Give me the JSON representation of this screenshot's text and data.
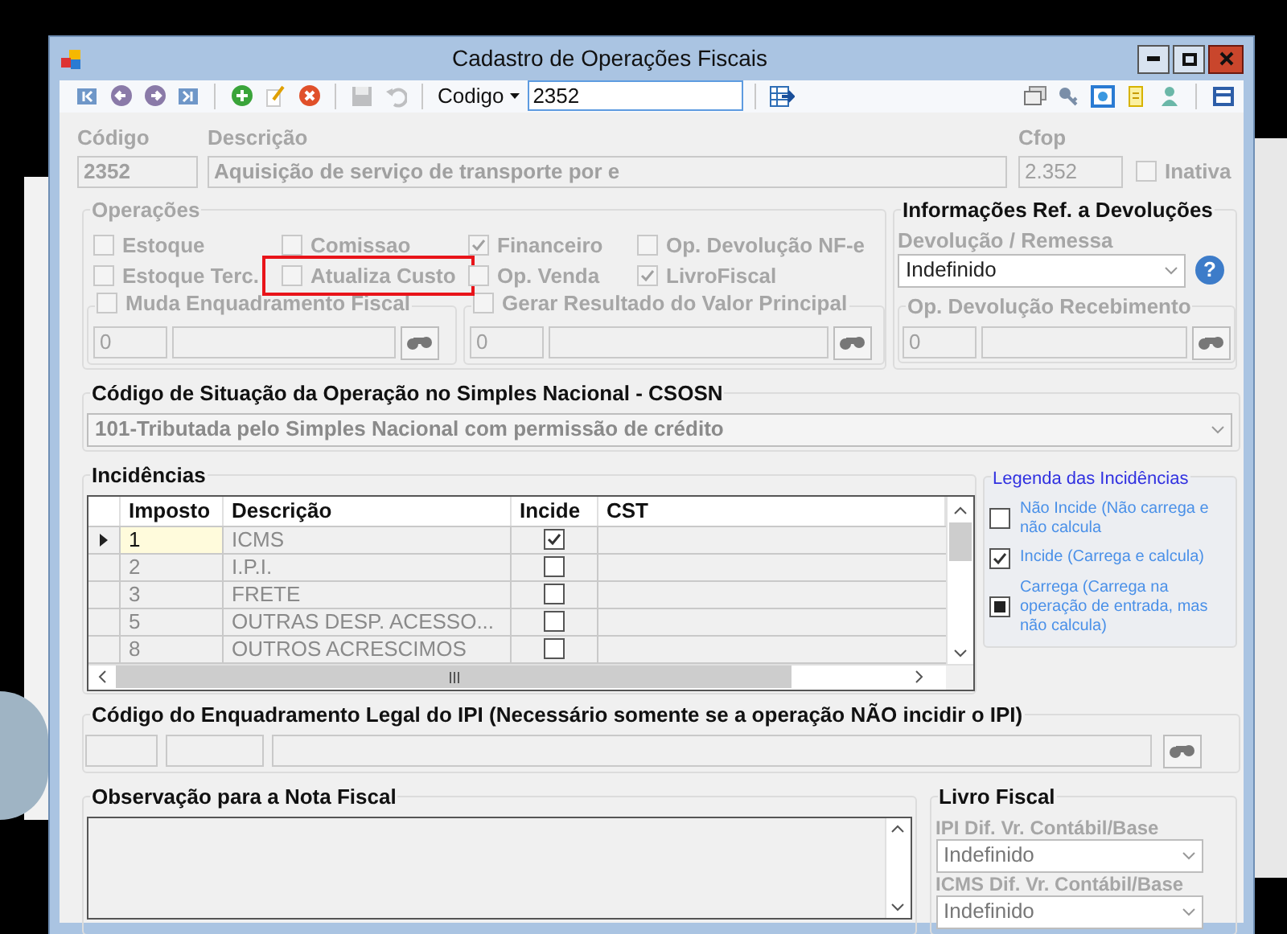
{
  "window": {
    "title": "Cadastro de Operações Fiscais"
  },
  "toolbar": {
    "search_by": "Codigo",
    "search_value": "2352"
  },
  "header": {
    "codigo": {
      "label": "Código",
      "value": "2352"
    },
    "descricao": {
      "label": "Descrição",
      "value": "Aquisição de serviço de transporte por e"
    },
    "cfop": {
      "label": "Cfop",
      "value": "2.352"
    },
    "inativa": {
      "label": "Inativa",
      "checked": false
    }
  },
  "operacoes": {
    "title": "Operações",
    "options": [
      {
        "label": "Estoque",
        "checked": false,
        "highlighted": false
      },
      {
        "label": "Comissao",
        "checked": false,
        "highlighted": false
      },
      {
        "label": "Financeiro",
        "checked": true,
        "highlighted": false
      },
      {
        "label": "Op. Devolução NF-e",
        "checked": false,
        "highlighted": false
      },
      {
        "label": "Estoque Terc.",
        "checked": false,
        "highlighted": false
      },
      {
        "label": "Atualiza Custo",
        "checked": false,
        "highlighted": true
      },
      {
        "label": "Op. Venda",
        "checked": false,
        "highlighted": false
      },
      {
        "label": "LivroFiscal",
        "checked": true,
        "highlighted": false
      }
    ],
    "muda_enquadramento": {
      "label": "Muda Enquadramento Fiscal",
      "checked": false,
      "code": "0"
    },
    "gerar_resultado": {
      "label": "Gerar Resultado do Valor Principal",
      "checked": false,
      "code": "0"
    }
  },
  "devolucoes": {
    "title": "Informações Ref. a Devoluções",
    "remessa_label": "Devolução / Remessa",
    "remessa_value": "Indefinido",
    "help": "?",
    "recebimento_title": "Op. Devolução Recebimento",
    "recebimento_code": "0"
  },
  "csosn": {
    "title": "Código de Situação da Operação no Simples Nacional - CSOSN",
    "value": "101-Tributada pelo Simples Nacional com permissão de crédito"
  },
  "incidencias": {
    "title": "Incidências",
    "columns": [
      "Imposto",
      "Descrição",
      "Incide",
      "CST"
    ],
    "rows": [
      {
        "imposto": "1",
        "descricao": "ICMS",
        "incide": true,
        "selected": true
      },
      {
        "imposto": "2",
        "descricao": "I.P.I.",
        "incide": false,
        "selected": false
      },
      {
        "imposto": "3",
        "descricao": "FRETE",
        "incide": false,
        "selected": false
      },
      {
        "imposto": "5",
        "descricao": "OUTRAS DESP. ACESSO...",
        "incide": false,
        "selected": false
      },
      {
        "imposto": "8",
        "descricao": "OUTROS ACRESCIMOS",
        "incide": false,
        "selected": false
      }
    ]
  },
  "legenda": {
    "title": "Legenda das Incidências",
    "items": [
      {
        "kind": "unchecked",
        "text": "Não Incide (Não carrega e não calcula"
      },
      {
        "kind": "checked",
        "text": "Incide (Carrega e calcula)"
      },
      {
        "kind": "filled",
        "text": "Carrega (Carrega na operação de entrada, mas não calcula)"
      }
    ]
  },
  "ipi": {
    "title": "Código do Enquadramento Legal do IPI (Necessário somente se a operação NÃO incidir o IPI)"
  },
  "observacao": {
    "title": "Observação para a Nota Fiscal"
  },
  "livro_fiscal": {
    "title": "Livro Fiscal",
    "fields": [
      {
        "label": "IPI Dif. Vr. Contábil/Base",
        "value": "Indefinido"
      },
      {
        "label": "ICMS Dif. Vr. Contábil/Base",
        "value": "Indefinido"
      }
    ]
  }
}
